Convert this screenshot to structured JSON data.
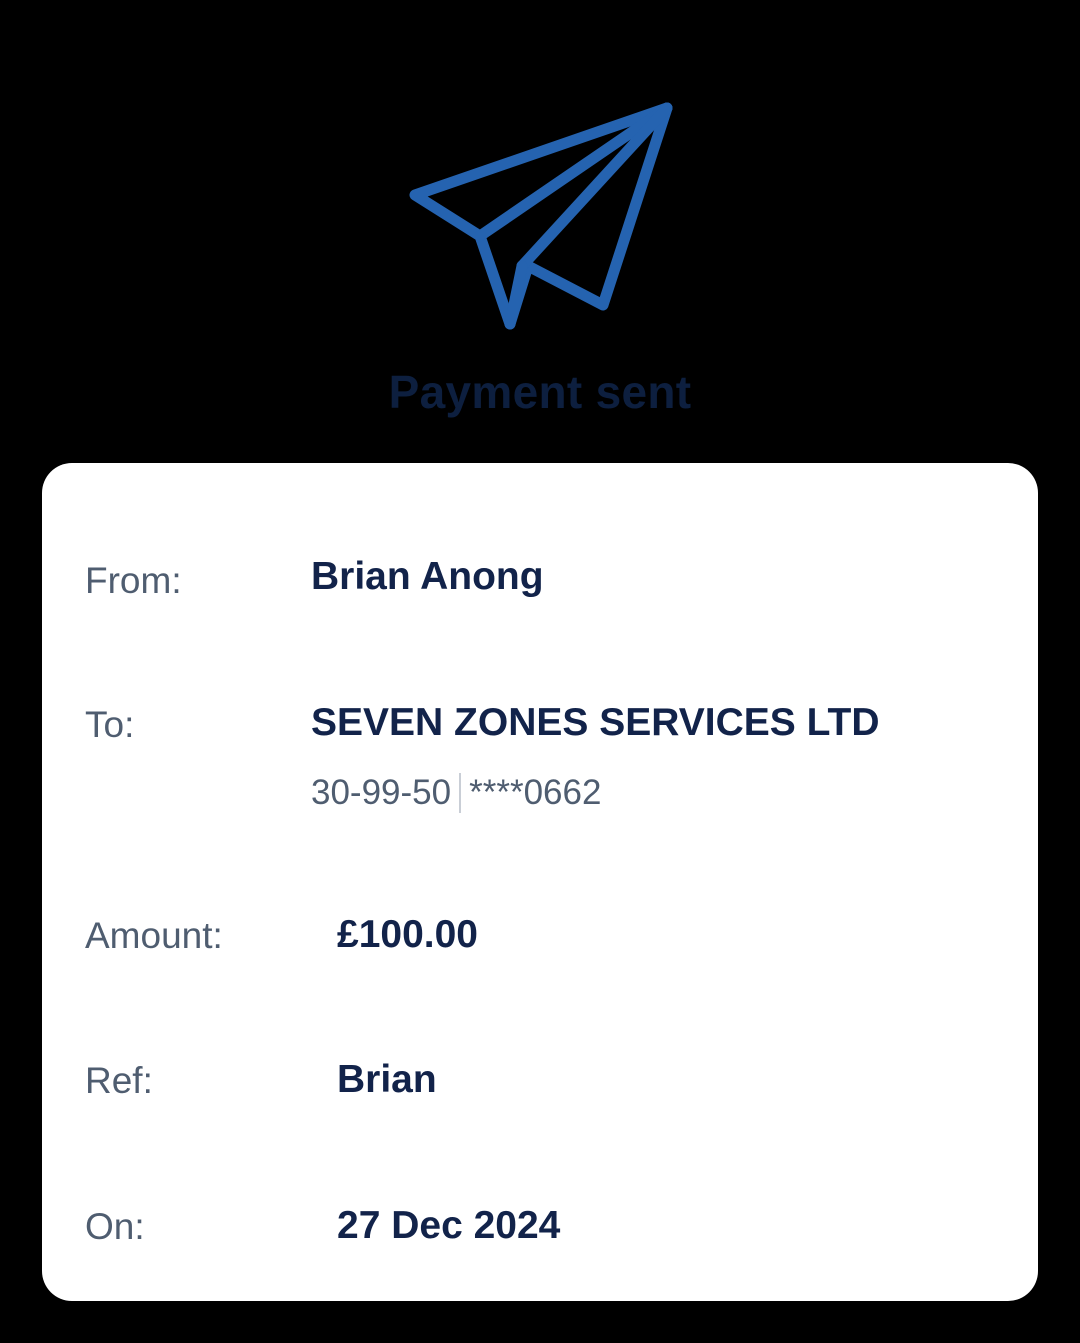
{
  "status": {
    "icon": "paper-plane-icon",
    "title": "Payment sent"
  },
  "details": {
    "from": {
      "label": "From:",
      "value": "Brian Anong"
    },
    "to": {
      "label": "To:",
      "value": "SEVEN ZONES SERVICES LTD",
      "sort_code": "30-99-50",
      "account": "****0662"
    },
    "amount": {
      "label": "Amount:",
      "value": "£100.00"
    },
    "ref": {
      "label": "Ref:",
      "value": "Brian"
    },
    "on": {
      "label": "On:",
      "value": "27 Dec 2024"
    }
  },
  "colors": {
    "background": "#000000",
    "icon": "#2563b0",
    "title": "#0d1f3f",
    "card": "#ffffff",
    "label": "#4f5d70",
    "value": "#12234a"
  }
}
